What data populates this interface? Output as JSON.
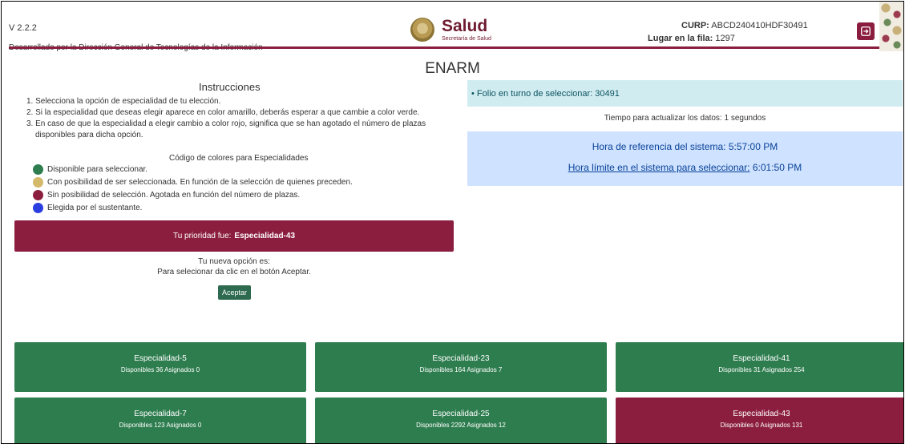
{
  "header": {
    "version": "V 2.2.2",
    "credits": "Desarrollado por la Dirección General de Tecnologías de la Información",
    "logo_word": "Salud",
    "logo_sub": "Secretaría de Salud",
    "curp_label": "CURP:",
    "curp_value": "ABCD240410HDF30491",
    "fila_label": "Lugar en la fila:",
    "fila_value": "1297",
    "exit_icon": "logout-icon",
    "accent_color": "#8b1e3f"
  },
  "page_title": "ENARM",
  "instructions": {
    "title": "Instrucciones",
    "items": [
      "1. Selecciona la opción de especialidad de tu elección.",
      "2. Si la especialidad que deseas elegir aparece en color amarillo, deberás esperar a que cambie a color verde.",
      "3. En caso de que la especialidad a elegir cambio a color rojo, significa que se han agotado el número de plazas disponibles para dicha opción."
    ],
    "legend_title": "Código de colores para Especialidades",
    "legend": [
      {
        "color": "#2e7d4f",
        "text": "Disponible para seleccionar."
      },
      {
        "color": "#d4b96a",
        "text": "Con posibilidad de ser seleccionada. En función de la selección de quienes preceden."
      },
      {
        "color": "#8b1e3f",
        "text": "Sin posibilidad de selección. Agotada en función del número de plazas."
      },
      {
        "color": "#2b3fe0",
        "text": "Elegida por el sustentante."
      }
    ]
  },
  "priority": {
    "label": "Tu prioridad fue:",
    "value": "Especialidad-43"
  },
  "new_option": {
    "line1": "Tu nueva opción es:",
    "line2": "Para selecionar da clic en el botón Aceptar.",
    "button": "Aceptar"
  },
  "status": {
    "folio": "Folio en turno de seleccionar: 30491",
    "refresh": "Tiempo para actualizar los datos: 1 segundos",
    "ref_time": "Hora de referencia del sistema: 5:57:00 PM",
    "limit_label": "Hora límite en el sistema para seleccionar:",
    "limit_time": "6:01:50 PM"
  },
  "specialties": [
    {
      "name": "Especialidad-5",
      "counts": "Disponibles 36 Asignados 0",
      "color": "#2e7d4f"
    },
    {
      "name": "Especialidad-23",
      "counts": "Disponibles 164 Asignados 7",
      "color": "#2e7d4f"
    },
    {
      "name": "Especialidad-41",
      "counts": "Disponibles 31 Asignados 254",
      "color": "#2e7d4f"
    },
    {
      "name": "Especialidad-7",
      "counts": "Disponibles 123 Asignados 0",
      "color": "#2e7d4f"
    },
    {
      "name": "Especialidad-25",
      "counts": "Disponibles 2292 Asignados 12",
      "color": "#2e7d4f"
    },
    {
      "name": "Especialidad-43",
      "counts": "Disponibles 0 Asignados 131",
      "color": "#8b1e3f"
    }
  ]
}
